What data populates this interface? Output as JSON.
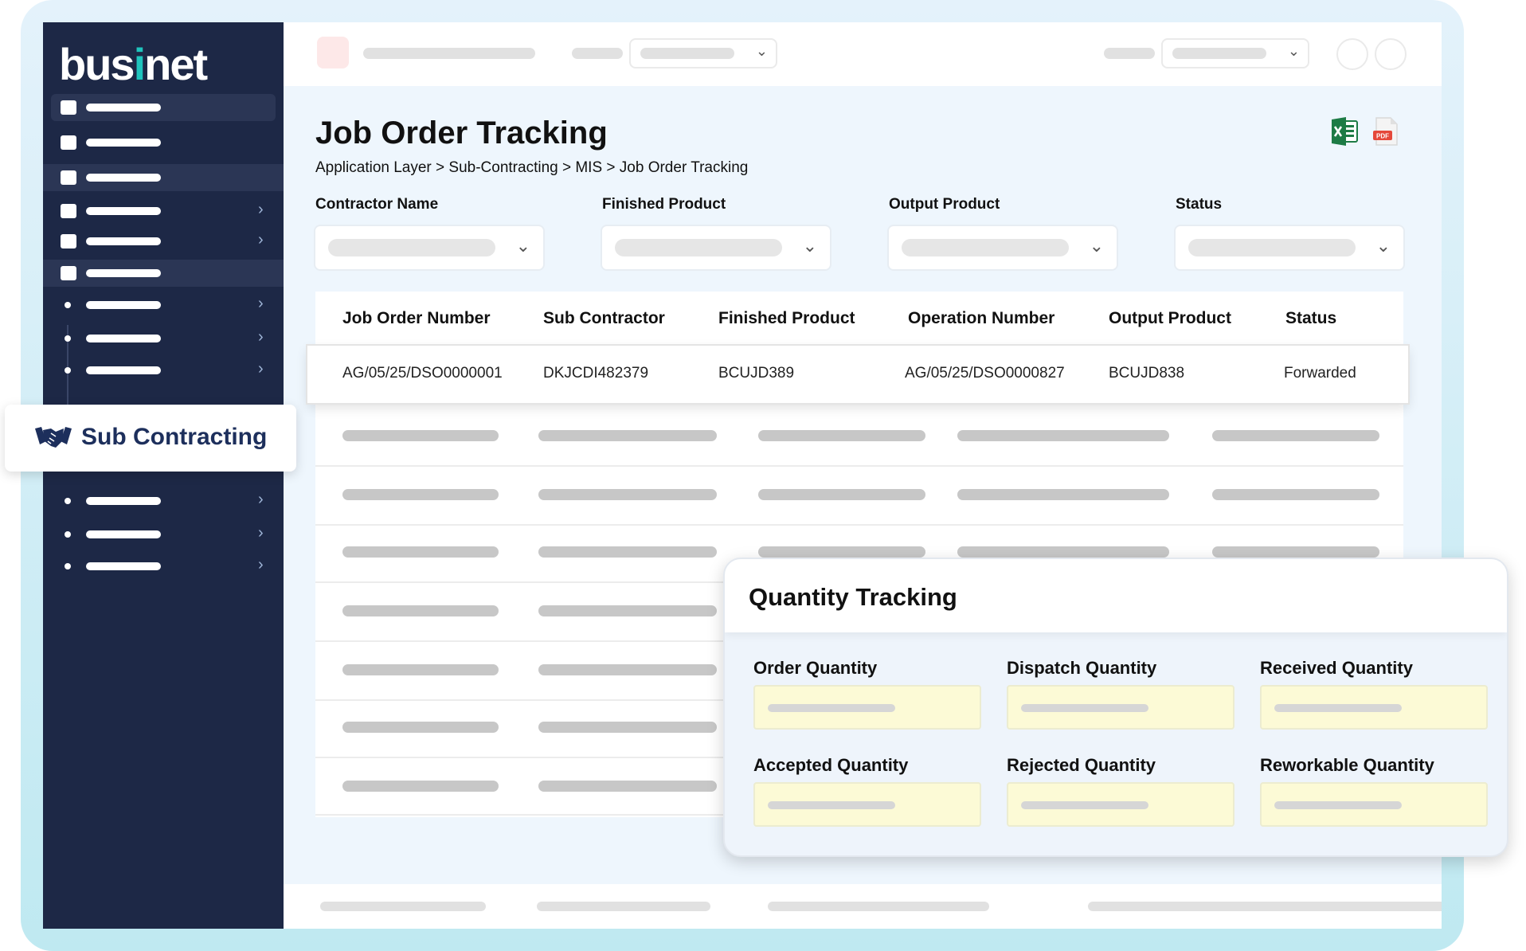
{
  "brand": {
    "logo_text_a": "bus",
    "logo_text_i": "i",
    "logo_text_b": "net"
  },
  "page": {
    "title": "Job Order Tracking",
    "breadcrumb": "Application Layer > Sub-Contracting > MIS > Job Order Tracking"
  },
  "exports": {
    "excel_icon": "excel-icon",
    "pdf_icon": "pdf-icon",
    "pdf_text": "PDF"
  },
  "filters": [
    {
      "label": "Contractor Name"
    },
    {
      "label": "Finished Product"
    },
    {
      "label": "Output Product"
    },
    {
      "label": "Status"
    }
  ],
  "table": {
    "headers": [
      "Job Order Number",
      "Sub Contractor",
      "Finished Product",
      "Operation Number",
      "Output Product",
      "Status"
    ],
    "row": [
      "AG/05/25/DSO0000001",
      "DKJCDI482379",
      "BCUJD389",
      "AG/05/25/DSO0000827",
      "BCUJD838",
      "Forwarded"
    ]
  },
  "sidebar": {
    "active_module": "Sub Contracting",
    "active_icon": "handshake-icon"
  },
  "quantity_tracking": {
    "title": "Quantity Tracking",
    "fields": [
      "Order Quantity",
      "Dispatch Quantity",
      "Received Quantity",
      "Accepted Quantity",
      "Rejected Quantity",
      "Reworkable Quantity"
    ]
  },
  "colors": {
    "sidebar_bg": "#1d2846",
    "accent_teal": "#1fc4bd",
    "callout_text": "#1d2f5c",
    "qty_field_bg": "#fcfad6"
  }
}
